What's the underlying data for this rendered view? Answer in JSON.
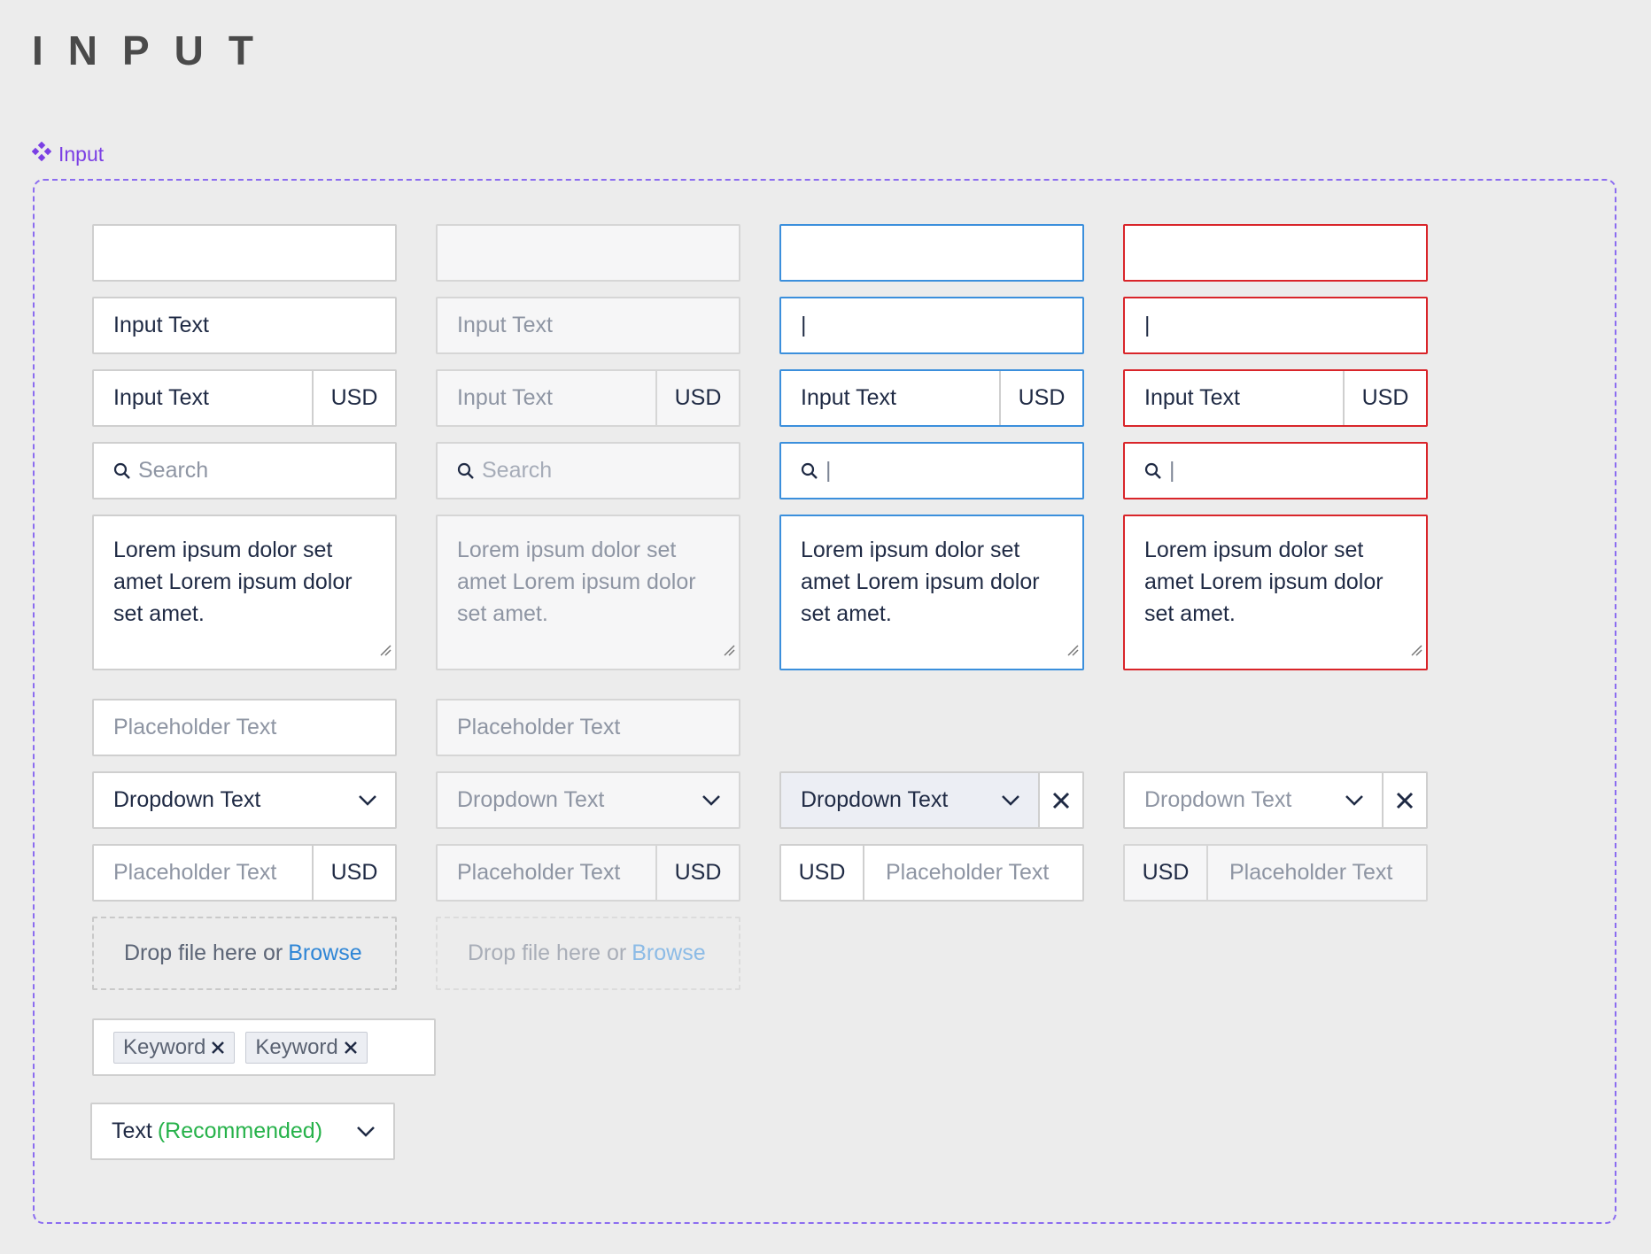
{
  "page": {
    "title": "INPUT"
  },
  "component": {
    "label": "Input"
  },
  "text_inputs": {
    "value": "Input Text",
    "cursor": "|"
  },
  "suffix": {
    "currency": "USD"
  },
  "search": {
    "placeholder": "Search",
    "cursor": "|"
  },
  "textarea": {
    "lines": [
      "Lorem ipsum dolor set",
      "amet Lorem ipsum dolor",
      "set amet."
    ]
  },
  "placeholder": {
    "text": "Placeholder Text"
  },
  "dropdown": {
    "text": "Dropdown Text"
  },
  "dropzone": {
    "text": "Drop file here or",
    "link": "Browse"
  },
  "keywords": {
    "tags": [
      "Keyword",
      "Keyword"
    ]
  },
  "select": {
    "value": "Text",
    "hint": "(Recommended)"
  },
  "colors": {
    "focus": "#3b8fdc",
    "error": "#d9252a",
    "accent": "#7b3fe4",
    "link": "#2f86d6",
    "recommended": "#26b24a"
  },
  "icons": [
    "component-icon",
    "search-icon",
    "chevron-down-icon",
    "close-icon",
    "resize-handle-icon"
  ]
}
